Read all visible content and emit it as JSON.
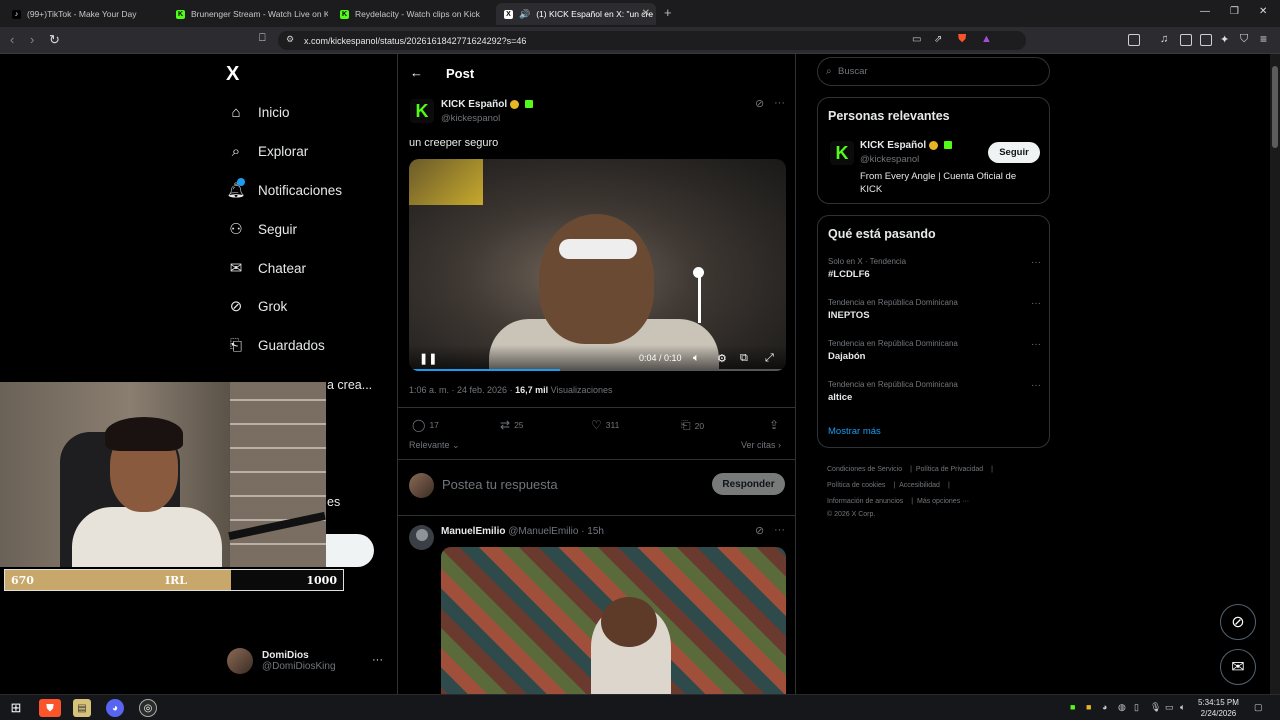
{
  "browser": {
    "tabs": [
      {
        "title": "(99+)TikTok - Make Your Day"
      },
      {
        "title": "Brunenger Stream - Watch Live on Ki"
      },
      {
        "title": "Reydelacity - Watch clips on Kick"
      },
      {
        "title": "(1) KICK Español en X: \"un cre"
      }
    ],
    "url": "x.com/kickespanol/status/2026161842771624292?s=46"
  },
  "nav": {
    "logo": "X",
    "items": [
      {
        "label": "Inicio"
      },
      {
        "label": "Explorar"
      },
      {
        "label": "Notificaciones"
      },
      {
        "label": "Seguir"
      },
      {
        "label": "Chatear"
      },
      {
        "label": "Grok"
      },
      {
        "label": "Guardados"
      }
    ],
    "partial_item_1": "a crea...",
    "partial_item_2": "es",
    "account": {
      "name": "DomiDios",
      "handle": "@DomiDiosKing"
    }
  },
  "post": {
    "header_title": "Post",
    "author": {
      "name": "KICK Español",
      "handle": "@kickespanol"
    },
    "text": "un creeper seguro",
    "video": {
      "time": "0:04 / 0:10",
      "progress_fraction": 0.4,
      "volume_fraction": 0.85
    },
    "meta": {
      "time": "1:06 a. m. · 24 feb. 2026 · ",
      "views_count": "16,7 mil",
      "views_label": "Visualizaciones"
    },
    "actions": {
      "replies": "17",
      "reposts": "25",
      "likes": "311",
      "bookmarks": "20"
    },
    "sort_label": "Relevante",
    "quotes_label": "Ver citas",
    "reply_placeholder": "Postea tu respuesta",
    "reply_button": "Responder"
  },
  "reply": {
    "name": "ManuelEmilio",
    "handle": "@ManuelEmilio",
    "age": "· 15h"
  },
  "sidebar": {
    "search_placeholder": "Buscar",
    "relevant": {
      "title": "Personas relevantes",
      "name": "KICK Español",
      "handle": "@kickespanol",
      "follow": "Seguir",
      "bio": "From Every Angle | Cuenta Oficial de KICK"
    },
    "trending": {
      "title": "Qué está pasando",
      "items": [
        {
          "context": "Solo en X · Tendencia",
          "title": "#LCDLF6"
        },
        {
          "context": "Tendencia en República Dominicana",
          "title": "INEPTOS"
        },
        {
          "context": "Tendencia en República Dominicana",
          "title": "Dajabón"
        },
        {
          "context": "Tendencia en República Dominicana",
          "title": "altice"
        }
      ],
      "show_more": "Mostrar más"
    },
    "footer": [
      "Condiciones de Servicio",
      "Política de Privacidad",
      "Política de cookies",
      "Accesibilidad",
      "Información de anuncios",
      "Más opciones ···",
      "© 2026 X Corp."
    ]
  },
  "overlay": {
    "bar_min": "670",
    "bar_label": "IRL",
    "bar_max": "1000",
    "bar_fraction": 0.67
  },
  "taskbar": {
    "time": "5:34:15 PM",
    "date": "2/24/2026"
  },
  "colors": {
    "accent": "#1d9bf0",
    "kick_green": "#53fc18",
    "verified_gold": "#e8b624"
  }
}
